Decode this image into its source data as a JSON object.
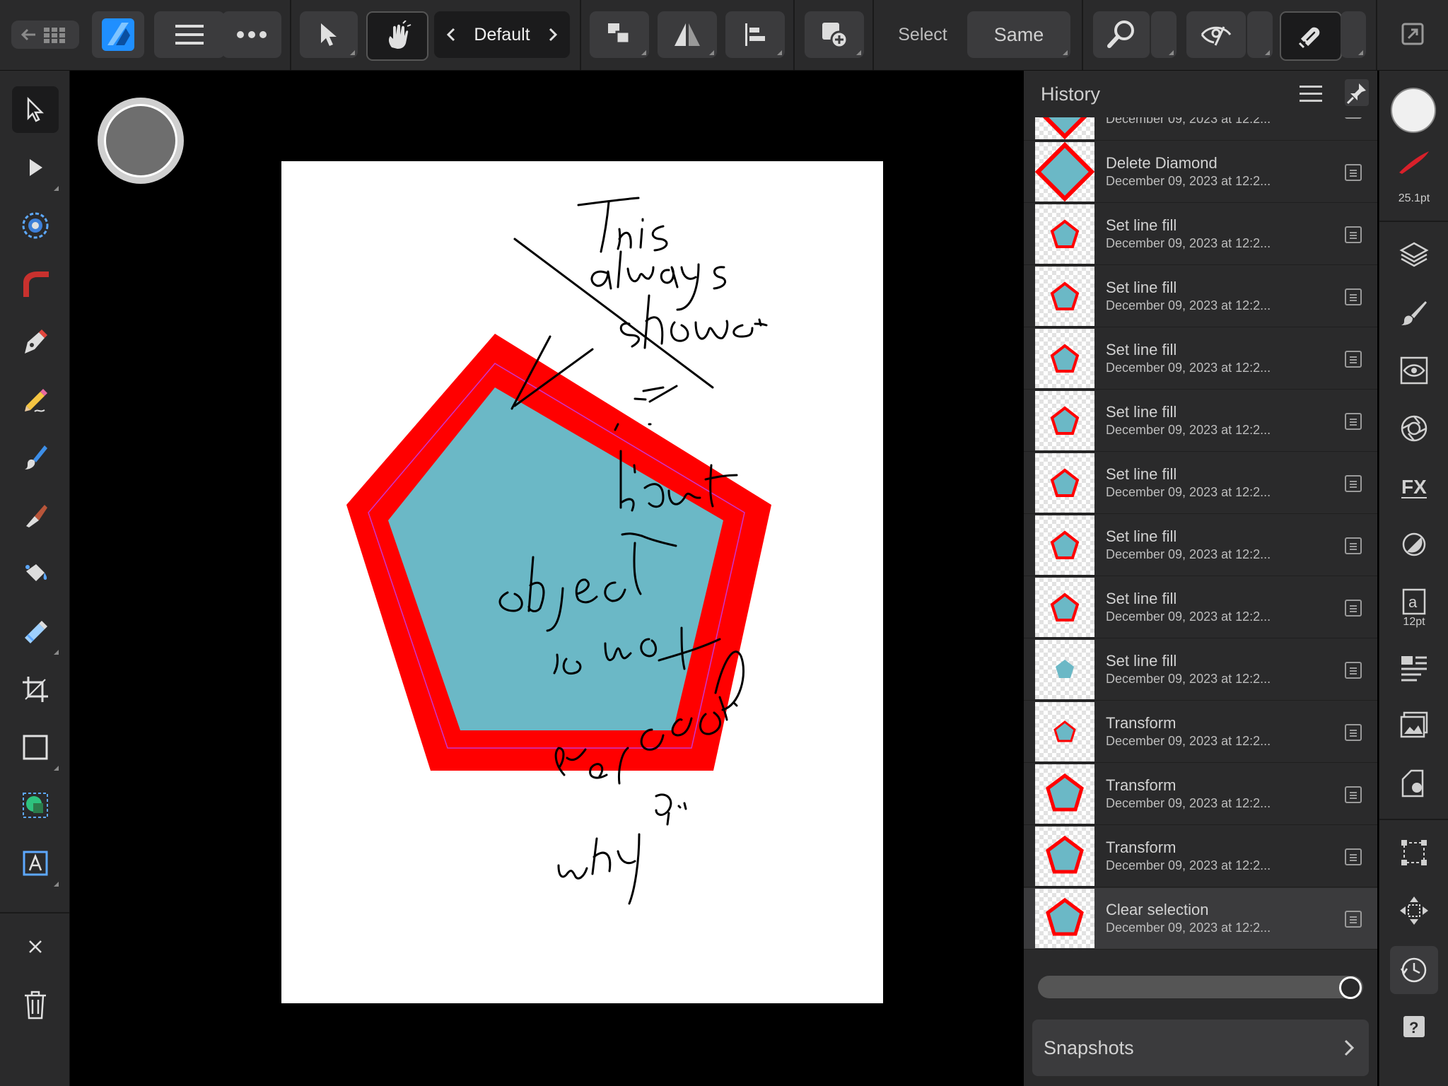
{
  "toolbar": {
    "persona": "Default",
    "select_label": "Select",
    "same_label": "Same"
  },
  "right_studio": {
    "brush_size": "25.1pt",
    "text_size": "12pt"
  },
  "history": {
    "title": "History",
    "items": [
      {
        "name": "",
        "date": "December 09, 2023 at 12:2...",
        "thumb": "diamond"
      },
      {
        "name": "Delete Diamond",
        "date": "December 09, 2023 at 12:2...",
        "thumb": "diamond"
      },
      {
        "name": "Set line fill",
        "date": "December 09, 2023 at 12:2...",
        "thumb": "pentagon-small"
      },
      {
        "name": "Set line fill",
        "date": "December 09, 2023 at 12:2...",
        "thumb": "pentagon-small"
      },
      {
        "name": "Set line fill",
        "date": "December 09, 2023 at 12:2...",
        "thumb": "pentagon-small"
      },
      {
        "name": "Set line fill",
        "date": "December 09, 2023 at 12:2...",
        "thumb": "pentagon-small"
      },
      {
        "name": "Set line fill",
        "date": "December 09, 2023 at 12:2...",
        "thumb": "pentagon-small"
      },
      {
        "name": "Set line fill",
        "date": "December 09, 2023 at 12:2...",
        "thumb": "pentagon-small"
      },
      {
        "name": "Set line fill",
        "date": "December 09, 2023 at 12:2...",
        "thumb": "pentagon-small"
      },
      {
        "name": "Set line fill",
        "date": "December 09, 2023 at 12:2...",
        "thumb": "pentagon-nostroke"
      },
      {
        "name": "Transform",
        "date": "December 09, 2023 at 12:2...",
        "thumb": "pentagon-tiny"
      },
      {
        "name": "Transform",
        "date": "December 09, 2023 at 12:2...",
        "thumb": "pentagon-large"
      },
      {
        "name": "Transform",
        "date": "December 09, 2023 at 12:2...",
        "thumb": "pentagon-large"
      },
      {
        "name": "Clear selection",
        "date": "December 09, 2023 at 12:2...",
        "thumb": "pentagon-large",
        "selected": true
      }
    ],
    "snapshots_label": "Snapshots",
    "slider_value": 1.0
  },
  "colors": {
    "accent_blue": "#1f8fff",
    "stroke_red": "#ff0000",
    "fill_teal": "#6bb8c6"
  }
}
